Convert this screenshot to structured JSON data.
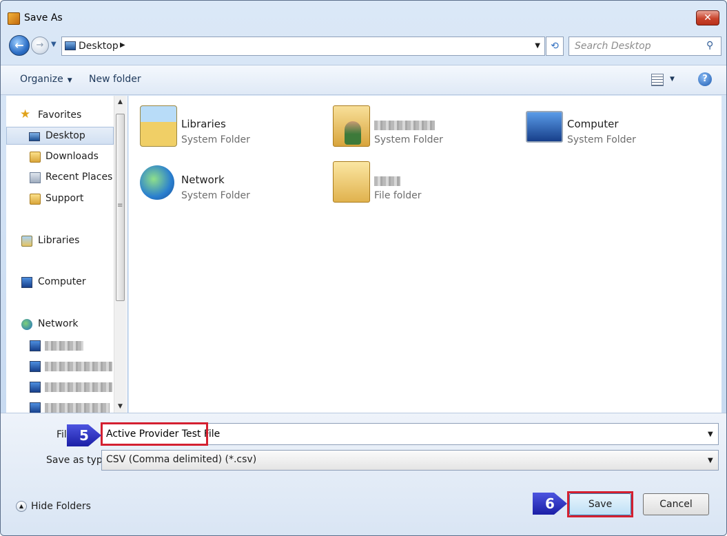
{
  "window": {
    "title": "Save As",
    "close_label": "✕"
  },
  "address": {
    "location": "Desktop",
    "search_placeholder": "Search Desktop"
  },
  "toolbar": {
    "organize_label": "Organize",
    "new_folder_label": "New folder",
    "help_label": "?"
  },
  "nav_pane": {
    "favorites_label": "Favorites",
    "favorites": [
      "Desktop",
      "Downloads",
      "Recent Places",
      "Support"
    ],
    "selected": "Desktop",
    "libraries_label": "Libraries",
    "computer_label": "Computer",
    "network_label": "Network"
  },
  "content": {
    "items": [
      {
        "name": "Libraries",
        "desc": "System Folder",
        "icon": "libraries-icon"
      },
      {
        "name": "",
        "desc": "System Folder",
        "icon": "user-folder-icon",
        "redacted": true
      },
      {
        "name": "Computer",
        "desc": "System Folder",
        "icon": "computer-icon"
      },
      {
        "name": "Network",
        "desc": "System Folder",
        "icon": "network-icon"
      },
      {
        "name": "",
        "desc": "File folder",
        "icon": "folder-icon",
        "redacted": true
      }
    ]
  },
  "form": {
    "file_name_label": "Fil",
    "file_name_value": "Active Provider Test File",
    "save_type_label": "Save as type:",
    "save_type_value": "CSV (Comma delimited) (*.csv)"
  },
  "footer": {
    "hide_folders_label": "Hide Folders",
    "save_label": "Save",
    "cancel_label": "Cancel"
  },
  "callouts": {
    "step_a": "5",
    "step_b": "6"
  },
  "colors": {
    "highlight": "#d42030",
    "callout": "#2a2fc0",
    "accent": "#3c7fb1"
  }
}
